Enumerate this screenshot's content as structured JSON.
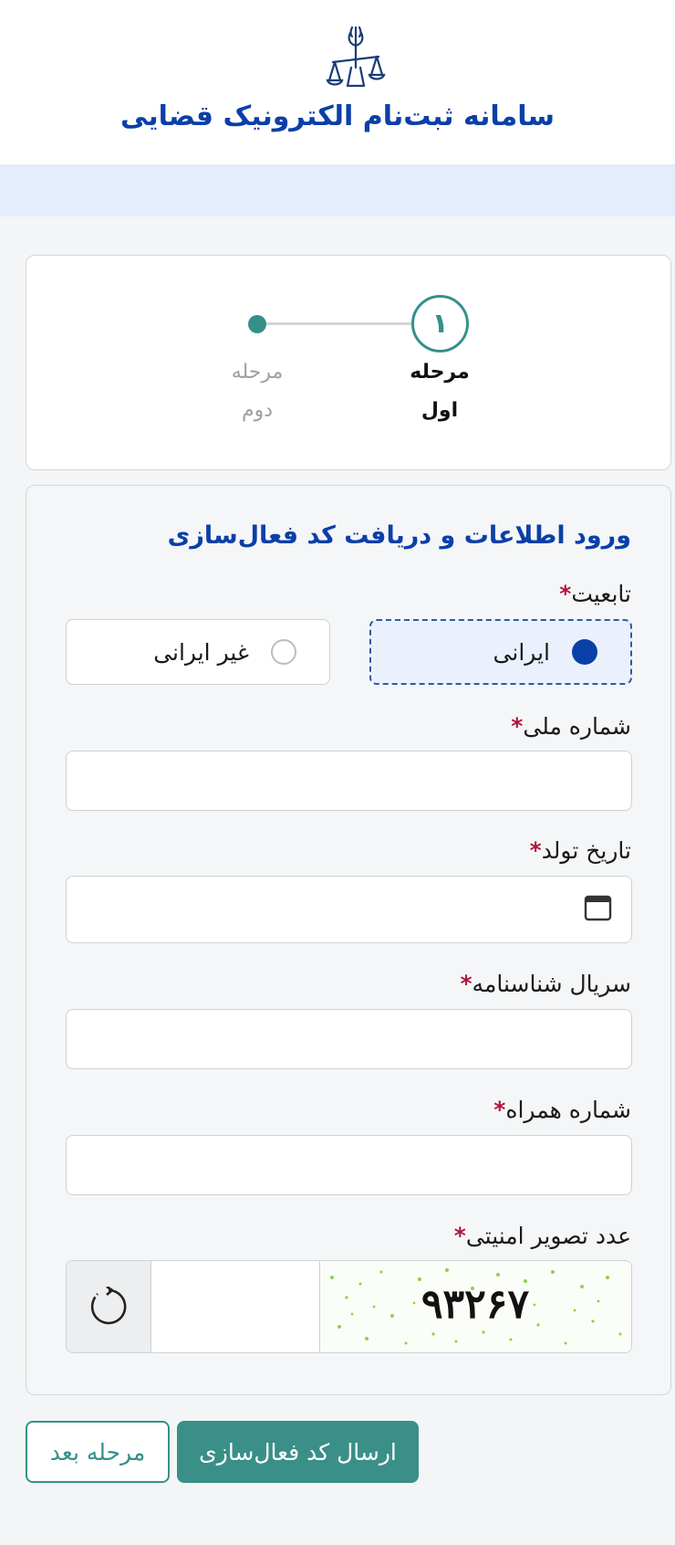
{
  "header": {
    "title": "سامانه ثبت‌نام الکترونیک قضایی",
    "emblem_icon": "judiciary-scales-emblem-icon"
  },
  "steps": [
    {
      "number": "۱",
      "label_line1": "مرحله",
      "label_line2": "اول",
      "state": "active"
    },
    {
      "label_line1": "مرحله",
      "label_line2": "دوم",
      "state": "inactive"
    }
  ],
  "form": {
    "section_title": "ورود اطلاعات و دریافت کد فعال‌سازی",
    "required_mark": "*",
    "nationality": {
      "label": "تابعیت",
      "options": [
        {
          "label": "ایرانی",
          "selected": true
        },
        {
          "label": "غیر ایرانی",
          "selected": false
        }
      ]
    },
    "national_id": {
      "label": "شماره ملی",
      "value": ""
    },
    "birth_date": {
      "label": "تاریخ تولد",
      "value": "",
      "icon": "calendar-icon"
    },
    "id_serial": {
      "label": "سریال شناسنامه",
      "value": ""
    },
    "mobile": {
      "label": "شماره همراه",
      "value": ""
    },
    "captcha": {
      "label": "عدد تصویر امنیتی",
      "image_text": "۹۳۲۶۷",
      "value": "",
      "refresh_icon": "refresh-icon"
    }
  },
  "buttons": {
    "send_code": "ارسال کد فعال‌سازی",
    "next_step": "مرحله بعد"
  },
  "colors": {
    "brand_blue": "#0b3fa8",
    "teal": "#35908a",
    "required_red": "#b0153d"
  }
}
